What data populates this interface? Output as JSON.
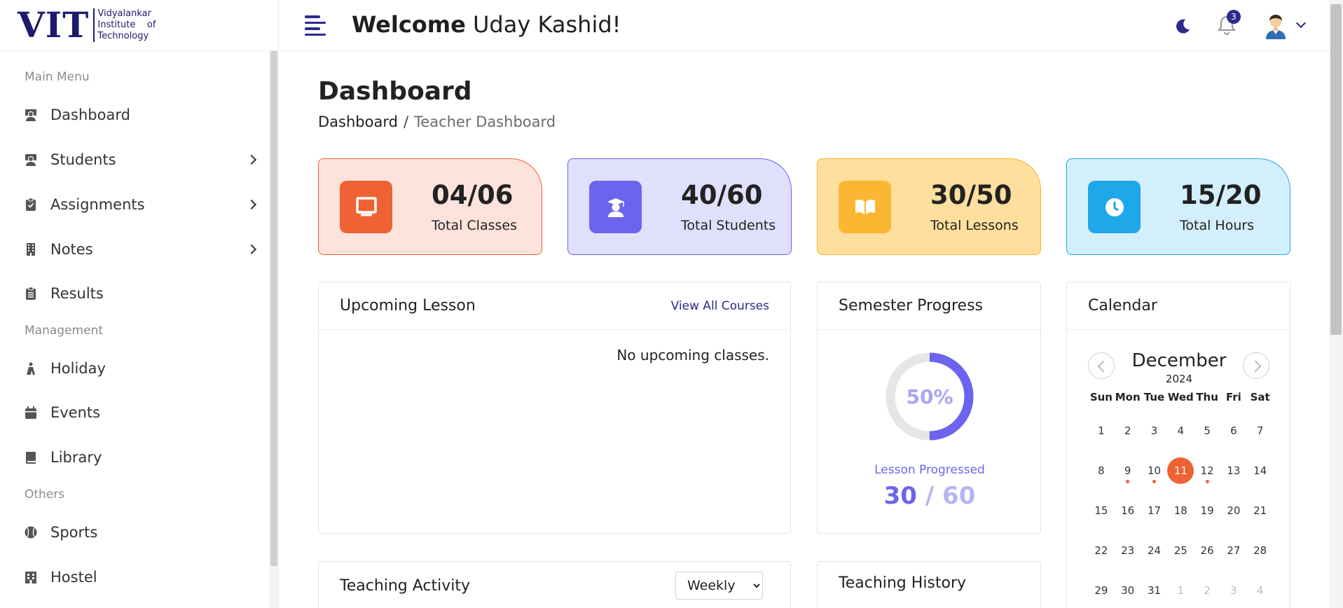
{
  "logo": {
    "mark": "VIT",
    "lines": [
      "Vidyalankar",
      "Institute    of",
      "Technology"
    ]
  },
  "sidebar": {
    "sections": [
      "Main Menu",
      "Management",
      "Others"
    ],
    "items": [
      {
        "label": "Dashboard",
        "icon": "teacher-icon"
      },
      {
        "label": "Students",
        "icon": "student-icon"
      },
      {
        "label": "Assignments",
        "icon": "clipboard-check-icon"
      },
      {
        "label": "Notes",
        "icon": "building-icon"
      },
      {
        "label": "Results",
        "icon": "clipboard-list-icon"
      },
      {
        "label": "Holiday",
        "icon": "holiday-icon"
      },
      {
        "label": "Events",
        "icon": "calendar-icon"
      },
      {
        "label": "Library",
        "icon": "book-icon"
      },
      {
        "label": "Sports",
        "icon": "baseball-icon"
      },
      {
        "label": "Hostel",
        "icon": "hotel-icon"
      }
    ]
  },
  "header": {
    "welcome_bold": "Welcome",
    "welcome_name": " Uday Kashid!",
    "notification_count": "3"
  },
  "page": {
    "title": "Dashboard",
    "breadcrumb": [
      "Dashboard",
      "/",
      "Teacher Dashboard"
    ]
  },
  "stats": [
    {
      "value": "04/06",
      "label": "Total Classes",
      "bg": "#fde3dc",
      "border": "#ef6233",
      "icon_bg": "#ef6233",
      "icon": "monitor-icon"
    },
    {
      "value": "40/60",
      "label": "Total Students",
      "bg": "#e0e0fc",
      "border": "#6c63ef",
      "icon_bg": "#6c63ef",
      "icon": "graduate-icon"
    },
    {
      "value": "30/50",
      "label": "Total Lessons",
      "bg": "#ffdf9e",
      "border": "#f4b52a",
      "icon_bg": "#fbb731",
      "icon": "open-book-icon"
    },
    {
      "value": "15/20",
      "label": "Total Hours",
      "bg": "#d3effc",
      "border": "#1ea7e9",
      "icon_bg": "#1ea7e9",
      "icon": "clock-icon"
    }
  ],
  "upcoming": {
    "title": "Upcoming Lesson",
    "link": "View All Courses",
    "empty": "No upcoming classes."
  },
  "semester": {
    "title": "Semester Progress",
    "percent_label": "50%",
    "progress": 0.5,
    "caption": "Lesson Progressed",
    "done": "30",
    "sep": " / ",
    "total": "60"
  },
  "calendar": {
    "title": "Calendar",
    "month": "December",
    "year": "2024",
    "dows": [
      "Sun",
      "Mon",
      "Tue",
      "Wed",
      "Thu",
      "Fri",
      "Sat"
    ],
    "weeks": [
      [
        "1",
        "2",
        "3",
        "4",
        "5",
        "6",
        "7"
      ],
      [
        "8",
        "9",
        "10",
        "11",
        "12",
        "13",
        "14"
      ],
      [
        "15",
        "16",
        "17",
        "18",
        "19",
        "20",
        "21"
      ],
      [
        "22",
        "23",
        "24",
        "25",
        "26",
        "27",
        "28"
      ],
      [
        "29",
        "30",
        "31",
        "1",
        "2",
        "3",
        "4"
      ]
    ]
  },
  "activity": {
    "title": "Teaching Activity",
    "period": "Weekly"
  },
  "history": {
    "title": "Teaching History"
  }
}
